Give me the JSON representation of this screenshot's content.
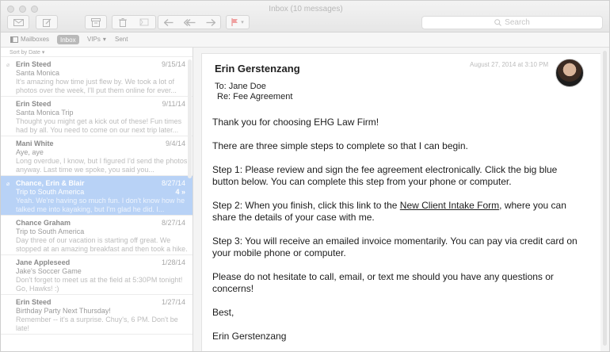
{
  "window": {
    "title": "Inbox (10 messages)"
  },
  "toolbar": {
    "icons": [
      "envelope-icon",
      "compose-icon",
      "archive-icon",
      "trash-icon",
      "junk-icon",
      "reply-icon",
      "reply-all-icon",
      "forward-icon",
      "flag-icon"
    ],
    "search_placeholder": "Search"
  },
  "favorites": {
    "mailboxes": "Mailboxes",
    "inbox": "Inbox",
    "vips": "VIPs",
    "sent": "Sent"
  },
  "list": {
    "sort_label": "Sort by Date",
    "messages": [
      {
        "from": "Erin Steed",
        "date": "9/15/14",
        "subject": "Santa Monica",
        "preview": "It's amazing how time just flew by. We took a lot of photos over the week, I'll put them online for ever..."
      },
      {
        "from": "Erin Steed",
        "date": "9/11/14",
        "subject": "Santa Monica Trip",
        "preview": "Thought you might get a kick out of these! Fun times had by all. You need to come on our next trip later..."
      },
      {
        "from": "Mani White",
        "date": "9/4/14",
        "subject": "Aye, aye",
        "preview": "Long overdue, I know, but I figured I'd send the photos anyway. Last time we spoke, you said you..."
      },
      {
        "from": "Chance, Erin & Blair",
        "date": "8/27/14",
        "subject": "Trip to South America",
        "preview": "Yeah. We're having so much fun. I don't know how he talked me into kayaking, but I'm glad he did. I...",
        "count": "4"
      },
      {
        "from": "Chance Graham",
        "date": "8/27/14",
        "subject": "Trip to South America",
        "preview": "Day three of our vacation is starting off great. We stopped at an amazing breakfast and then took a hike. I..."
      },
      {
        "from": "Jane Appleseed",
        "date": "1/28/14",
        "subject": "Jake's Soccer Game",
        "preview": "Don't forget to meet us at the field at 5:30PM tonight! Go, Hawks! :)"
      },
      {
        "from": "Erin Steed",
        "date": "1/27/14",
        "subject": "Birthday Party Next Thursday!",
        "preview": "Remember -- it's a surprise. Chuy's, 6 PM. Don't be late!"
      }
    ]
  },
  "message": {
    "sender": "Erin Gerstenzang",
    "to": "To: Jane Doe",
    "re": "Re: Fee Agreement",
    "date": "August 27, 2014 at 3:10 PM",
    "p1": "Thank you for choosing EHG Law Firm!",
    "p2": "There are three simple steps to complete so that I can begin.",
    "p3": "Step 1: Please review and sign the fee agreement electronically. Click the big blue button below. You can complete this step from your phone or computer.",
    "p4_before": "Step 2: When you finish, click this link to the ",
    "p4_link": "New Client Intake Form",
    "p4_after": ", where you can share the details of your case with me.",
    "p5": "Step 3: You will receive an emailed invoice momentarily. You can pay via credit card on your mobile phone or computer.",
    "p6": "Please do not hesitate to call, email, or text me should you have any questions or concerns!",
    "p7": "Best,",
    "p8": "Erin Gerstenzang"
  }
}
